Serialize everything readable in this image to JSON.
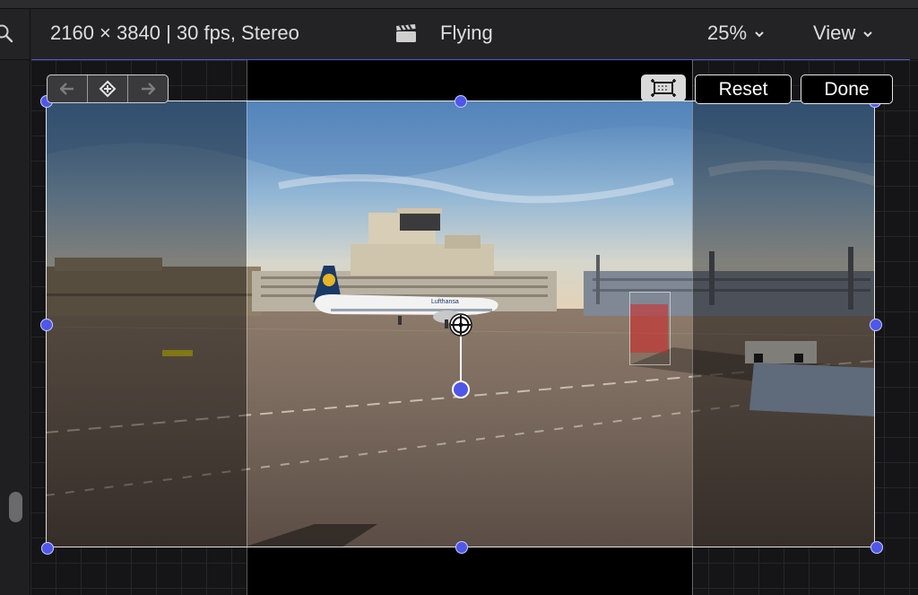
{
  "header": {
    "format": "2160 × 3840 | 30 fps, Stereo",
    "project_name": "Flying",
    "zoom_label": "25%",
    "view_label": "View"
  },
  "toolbar": {
    "reset_label": "Reset",
    "done_label": "Done"
  },
  "photo": {
    "airline_text": "Lufthansa"
  },
  "icons": {
    "search": "search-icon",
    "clapper": "clapperboard-icon",
    "prev_keyframe": "arrow-left-icon",
    "add_keyframe": "diamond-keyframe-icon",
    "next_keyframe": "arrow-right-icon",
    "crop_mode": "crop-frame-icon"
  },
  "colors": {
    "accent": "#4f57e8",
    "tracker_region": "#d62626"
  }
}
